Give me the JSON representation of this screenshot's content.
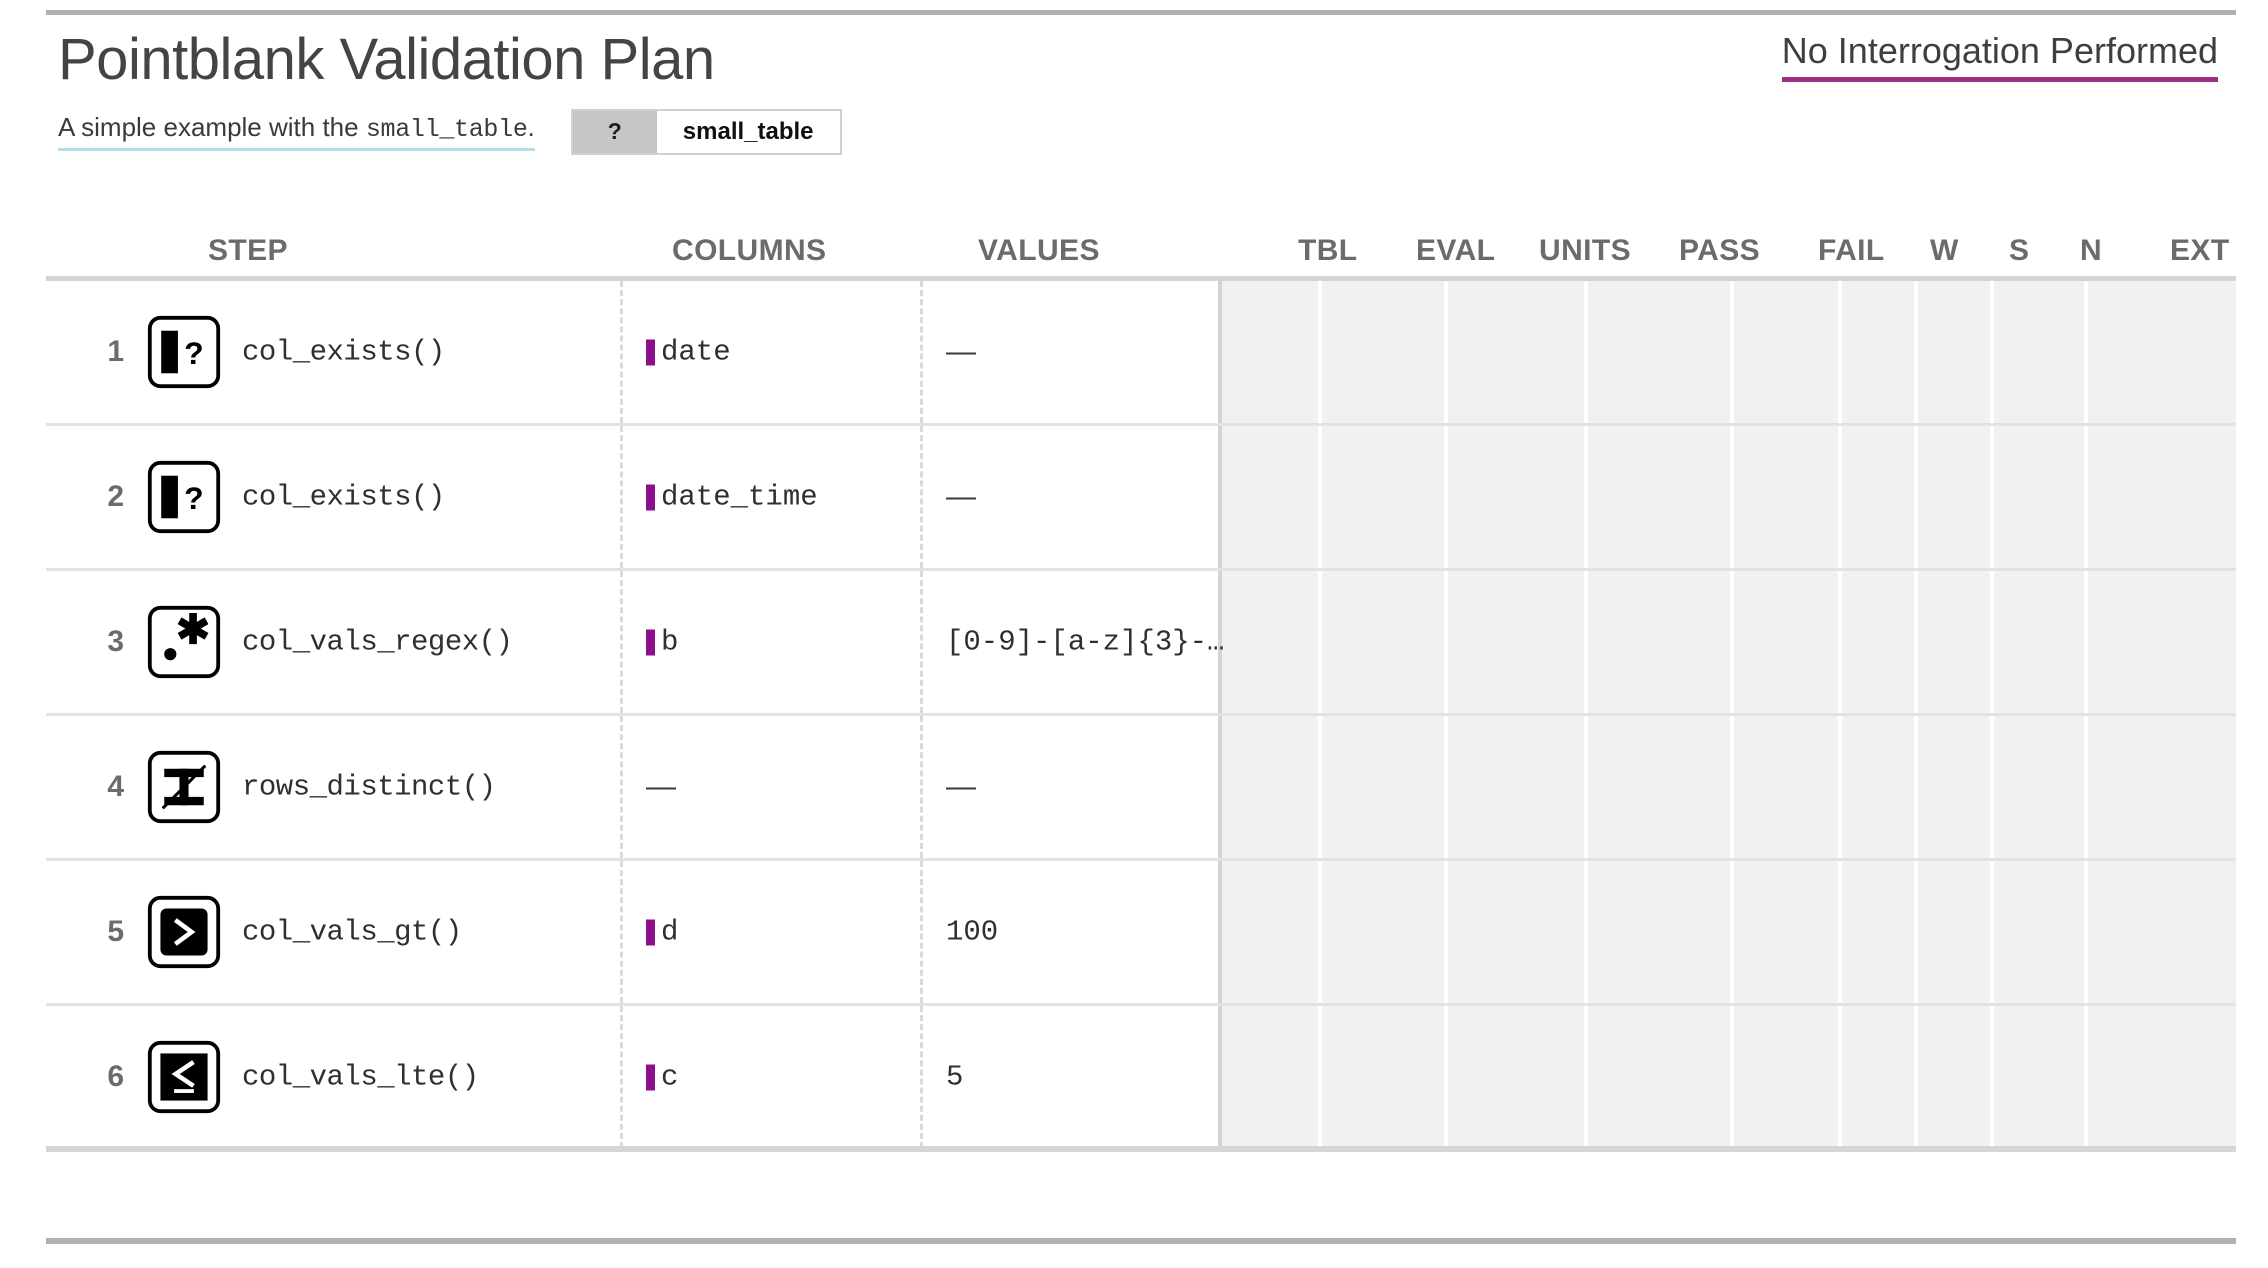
{
  "header": {
    "title": "Pointblank Validation Plan",
    "subtitle_prefix": "A simple example with the ",
    "subtitle_table": "small_table",
    "subtitle_suffix": ".",
    "table_pill": {
      "help_label": "?",
      "table_name": "small_table"
    },
    "status": "No Interrogation Performed"
  },
  "table": {
    "headers": {
      "step": "STEP",
      "columns": "COLUMNS",
      "values": "VALUES",
      "tbl": "TBL",
      "eval": "EVAL",
      "units": "UNITS",
      "pass": "PASS",
      "fail": "FAIL",
      "w": "W",
      "s": "S",
      "n": "N",
      "ext": "EXT"
    },
    "rows": [
      {
        "step": "1",
        "icon": "col-exists-icon",
        "assertion": "col_exists()",
        "column": "date",
        "has_column_swatch": true,
        "value": "—",
        "value_is_dash": true,
        "tbl": "",
        "eval": "",
        "units": "",
        "pass": "",
        "fail": "",
        "w": "",
        "s": "",
        "n": "",
        "ext": ""
      },
      {
        "step": "2",
        "icon": "col-exists-icon",
        "assertion": "col_exists()",
        "column": "date_time",
        "has_column_swatch": true,
        "value": "—",
        "value_is_dash": true,
        "tbl": "",
        "eval": "",
        "units": "",
        "pass": "",
        "fail": "",
        "w": "",
        "s": "",
        "n": "",
        "ext": ""
      },
      {
        "step": "3",
        "icon": "col-vals-regex-icon",
        "assertion": "col_vals_regex()",
        "column": "b",
        "has_column_swatch": true,
        "value": "[0-9]-[a-z]{3}-…",
        "value_is_dash": false,
        "tbl": "",
        "eval": "",
        "units": "",
        "pass": "",
        "fail": "",
        "w": "",
        "s": "",
        "n": "",
        "ext": ""
      },
      {
        "step": "4",
        "icon": "rows-distinct-icon",
        "assertion": "rows_distinct()",
        "column": "—",
        "has_column_swatch": false,
        "value": "—",
        "value_is_dash": true,
        "tbl": "",
        "eval": "",
        "units": "",
        "pass": "",
        "fail": "",
        "w": "",
        "s": "",
        "n": "",
        "ext": ""
      },
      {
        "step": "5",
        "icon": "col-vals-gt-icon",
        "assertion": "col_vals_gt()",
        "column": "d",
        "has_column_swatch": true,
        "value": "100",
        "value_is_dash": false,
        "tbl": "",
        "eval": "",
        "units": "",
        "pass": "",
        "fail": "",
        "w": "",
        "s": "",
        "n": "",
        "ext": ""
      },
      {
        "step": "6",
        "icon": "col-vals-lte-icon",
        "assertion": "col_vals_lte()",
        "column": "c",
        "has_column_swatch": true,
        "value": "5",
        "value_is_dash": false,
        "tbl": "",
        "eval": "",
        "units": "",
        "pass": "",
        "fail": "",
        "w": "",
        "s": "",
        "n": "",
        "ext": ""
      }
    ]
  },
  "colors": {
    "accent_magenta": "#9e2d84",
    "column_swatch": "#8c0f8c",
    "subtitle_underline": "#b8dce8",
    "rule_gray": "#b0b0b0",
    "gray_zone": "#f1f1f1"
  }
}
